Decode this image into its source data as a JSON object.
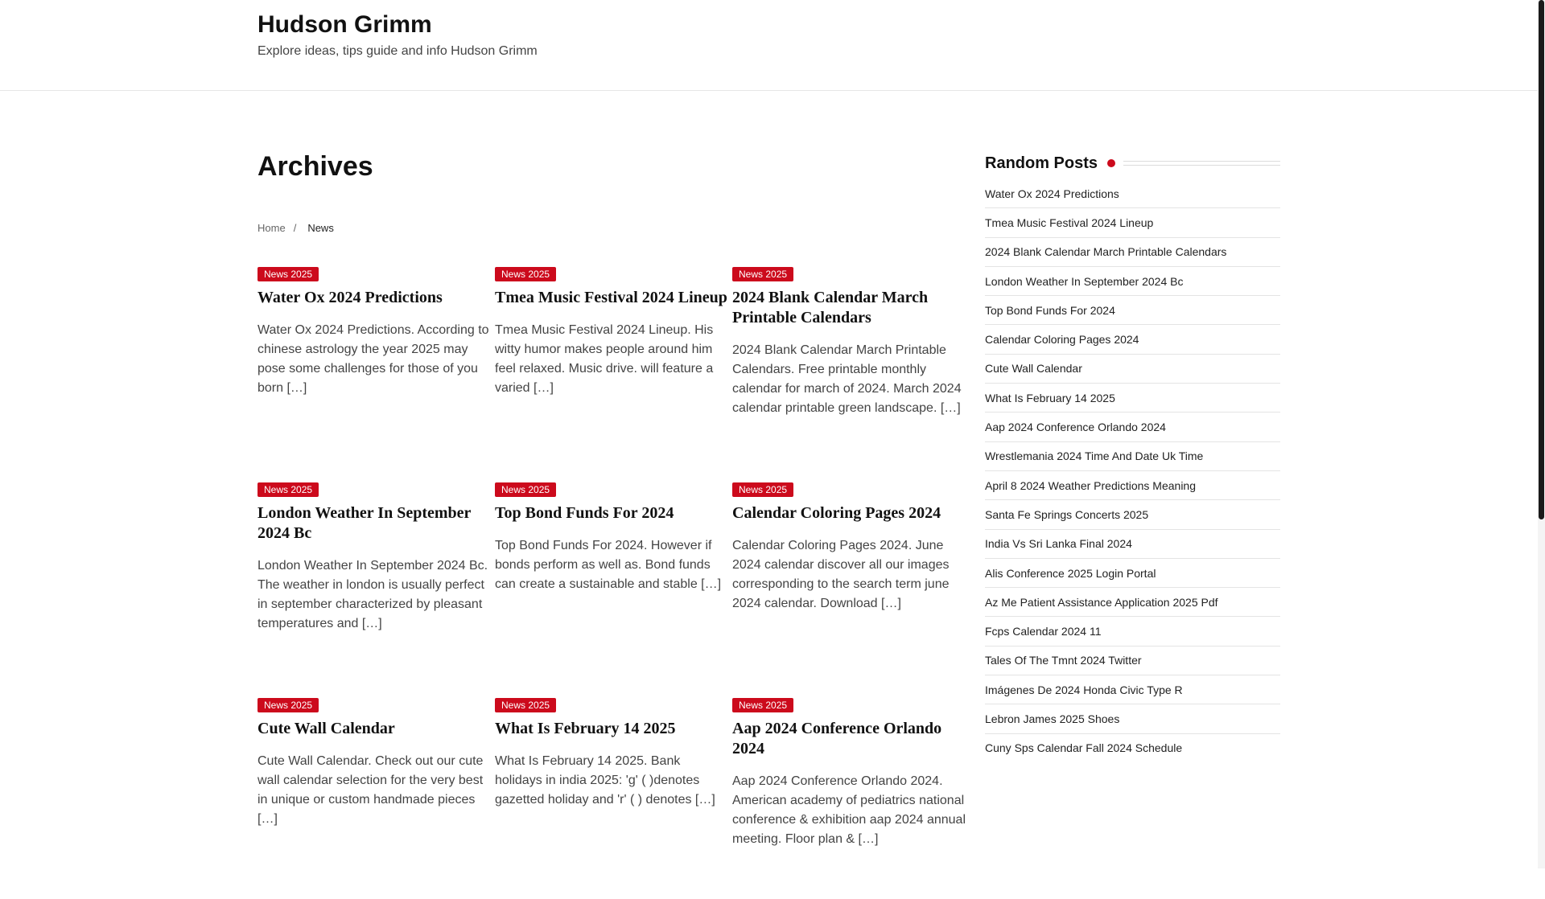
{
  "header": {
    "site_title": "Hudson Grimm",
    "site_description": "Explore ideas, tips guide and info Hudson Grimm"
  },
  "main": {
    "page_title": "Archives",
    "breadcrumb": {
      "home": "Home",
      "separator": "/",
      "current": "News"
    },
    "posts": [
      {
        "category": "News 2025",
        "title": "Water Ox 2024 Predictions",
        "excerpt": "Water Ox 2024 Predictions. According to chinese astrology the year 2025 may pose some challenges for those of you born […]"
      },
      {
        "category": "News 2025",
        "title": "Tmea Music Festival 2024 Lineup",
        "excerpt": "Tmea Music Festival 2024 Lineup. His witty humor makes people around him feel relaxed. Music drive. will feature a varied […]"
      },
      {
        "category": "News 2025",
        "title": "2024 Blank Calendar March Printable Calendars",
        "excerpt": "2024 Blank Calendar March Printable Calendars. Free printable monthly calendar for march of 2024. March 2024 calendar printable green landscape. […]"
      },
      {
        "category": "News 2025",
        "title": "London Weather In September 2024 Bc",
        "excerpt": "London Weather In September 2024 Bc. The weather in london is usually perfect in september characterized by pleasant temperatures and […]"
      },
      {
        "category": "News 2025",
        "title": "Top Bond Funds For 2024",
        "excerpt": "Top Bond Funds For 2024. However if bonds perform as well as. Bond funds can create a sustainable and stable […]"
      },
      {
        "category": "News 2025",
        "title": "Calendar Coloring Pages 2024",
        "excerpt": "Calendar Coloring Pages 2024. June 2024 calendar discover all our images corresponding to the search term june 2024 calendar. Download […]"
      },
      {
        "category": "News 2025",
        "title": "Cute Wall Calendar",
        "excerpt": "Cute Wall Calendar. Check out our cute wall calendar selection for the very best in unique or custom handmade pieces […]"
      },
      {
        "category": "News 2025",
        "title": "What Is February 14 2025",
        "excerpt": "What Is February 14 2025. Bank holidays in india 2025: 'g' ( )denotes gazetted holiday and 'r' ( ) denotes […]"
      },
      {
        "category": "News 2025",
        "title": "Aap 2024 Conference Orlando 2024",
        "excerpt": "Aap 2024 Conference Orlando 2024. American academy of pediatrics national conference & exhibition aap 2024 annual meeting. Floor plan & […]"
      }
    ]
  },
  "sidebar": {
    "widget_title": "Random Posts",
    "items": [
      "Water Ox 2024 Predictions",
      "Tmea Music Festival 2024 Lineup",
      "2024 Blank Calendar March Printable Calendars",
      "London Weather In September 2024 Bc",
      "Top Bond Funds For 2024",
      "Calendar Coloring Pages 2024",
      "Cute Wall Calendar",
      "What Is February 14 2025",
      "Aap 2024 Conference Orlando 2024",
      "Wrestlemania 2024 Time And Date Uk Time",
      "April 8 2024 Weather Predictions Meaning",
      "Santa Fe Springs Concerts 2025",
      "India Vs Sri Lanka Final 2024",
      "Alis Conference 2025 Login Portal",
      "Az Me Patient Assistance Application 2025 Pdf",
      "Fcps Calendar 2024 11",
      "Tales Of The Tmnt 2024 Twitter",
      "Imágenes De 2024 Honda Civic Type R",
      "Lebron James 2025 Shoes",
      "Cuny Sps Calendar Fall 2024 Schedule"
    ]
  },
  "colors": {
    "accent": "#cc0a1c",
    "text": "#222222",
    "muted": "#444444",
    "border": "#e4e4e4"
  }
}
